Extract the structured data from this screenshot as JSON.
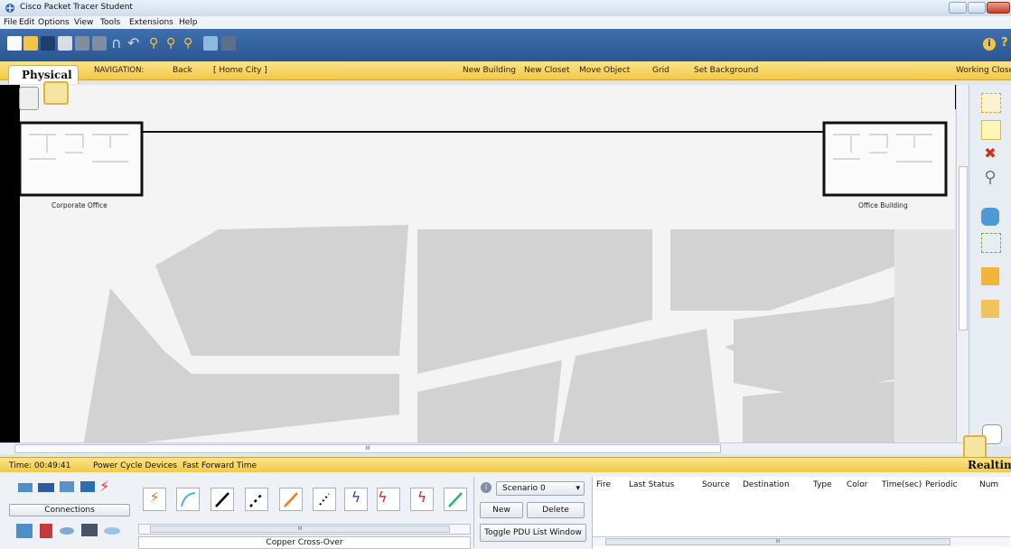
{
  "window": {
    "title": "Cisco Packet Tracer Student"
  },
  "menu": [
    "File",
    "Edit",
    "Options",
    "View",
    "Tools",
    "Extensions",
    "Help"
  ],
  "nav": {
    "mode_tab": "Physical",
    "navigation_label": "NAVIGATION:",
    "back": "Back",
    "location": "[ Home City ]",
    "new_building": "New Building",
    "new_closet": "New Closet",
    "move_object": "Move Object",
    "grid": "Grid",
    "set_background": "Set Background",
    "working_closet": "Working Closet"
  },
  "map": {
    "buildings": [
      {
        "label": "Corporate Office"
      },
      {
        "label": "Office Building"
      }
    ]
  },
  "status": {
    "time": "Time: 00:49:41",
    "power_cycle": "Power Cycle Devices",
    "fast_forward": "Fast Forward Time",
    "mode": "Realtime"
  },
  "device_panel": {
    "category": "Connections",
    "selected": "Copper Cross-Over"
  },
  "scenario": {
    "selected": "Scenario 0",
    "new": "New",
    "delete": "Delete",
    "toggle": "Toggle PDU List Window"
  },
  "pdu_table": {
    "columns": [
      "Fire",
      "Last Status",
      "Source",
      "Destination",
      "Type",
      "Color",
      "Time(sec)",
      "Periodic",
      "Num"
    ]
  },
  "scroll_glyph": "III",
  "colors": {
    "nav_yellow": "#f2c948",
    "toolbar_blue": "#2b5792",
    "road": "#f4f4f4",
    "block": "#d2d2d2"
  }
}
